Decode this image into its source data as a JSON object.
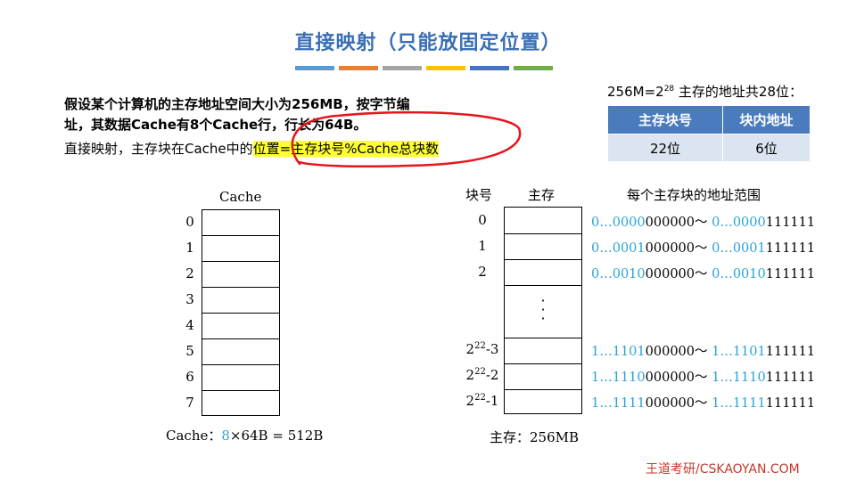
{
  "title": "直接映射（只能放固定位置）",
  "title_bar_colors": [
    "#5b9bd5",
    "#ed7d31",
    "#a5a5a5",
    "#ffc000",
    "#4472c4",
    "#70ad47"
  ],
  "intro": {
    "line1": "假设某个计算机的主存地址空间大小为256MB，按字节编",
    "line2": "址，其数据Cache有8个Cache行，行长为64B。",
    "line3_prefix": "直接映射，主存块在Cache中的",
    "line3_highlight": "位置=主存块号%Cache总块数"
  },
  "address": {
    "header_prefix": "256M=2",
    "header_exp": "28",
    "header_suffix": " 主存的地址共28位：",
    "columns": [
      "主存块号",
      "块内地址"
    ],
    "values": [
      "22位",
      "6位"
    ]
  },
  "cache": {
    "label": "Cache",
    "rows": [
      "0",
      "1",
      "2",
      "3",
      "4",
      "5",
      "6",
      "7"
    ],
    "footer_prefix": "Cache：",
    "footer_num": "8",
    "footer_suffix": "×64B = 512B"
  },
  "memory": {
    "col_block": "块号",
    "col_mem": "主存",
    "col_range": "每个主存块的地址范围",
    "blocks": [
      {
        "base": "0",
        "exp": "",
        "suffix": ""
      },
      {
        "base": "1",
        "exp": "",
        "suffix": ""
      },
      {
        "base": "2",
        "exp": "",
        "suffix": ""
      },
      {
        "base": "2",
        "exp": "22",
        "suffix": "-3"
      },
      {
        "base": "2",
        "exp": "22",
        "suffix": "-2"
      },
      {
        "base": "2",
        "exp": "22",
        "suffix": "-1"
      }
    ],
    "ranges": [
      {
        "a1": "0…0000",
        "b1": "000000～ ",
        "a2": "0…0000",
        "b2": "111111"
      },
      {
        "a1": "0…0001",
        "b1": "000000～ ",
        "a2": "0…0001",
        "b2": "111111"
      },
      {
        "a1": "0…0010",
        "b1": "000000～ ",
        "a2": "0…0010",
        "b2": "111111"
      },
      {
        "a1": "1…1101",
        "b1": "000000～ ",
        "a2": "1…1101",
        "b2": "111111"
      },
      {
        "a1": "1…1110",
        "b1": "000000～ ",
        "a2": "1…1110",
        "b2": "111111"
      },
      {
        "a1": "1…1111",
        "b1": "000000～ ",
        "a2": "1…1111",
        "b2": "111111"
      }
    ],
    "footer": "主存：256MB"
  },
  "brand": "王道考研/CSKAOYAN.COM"
}
